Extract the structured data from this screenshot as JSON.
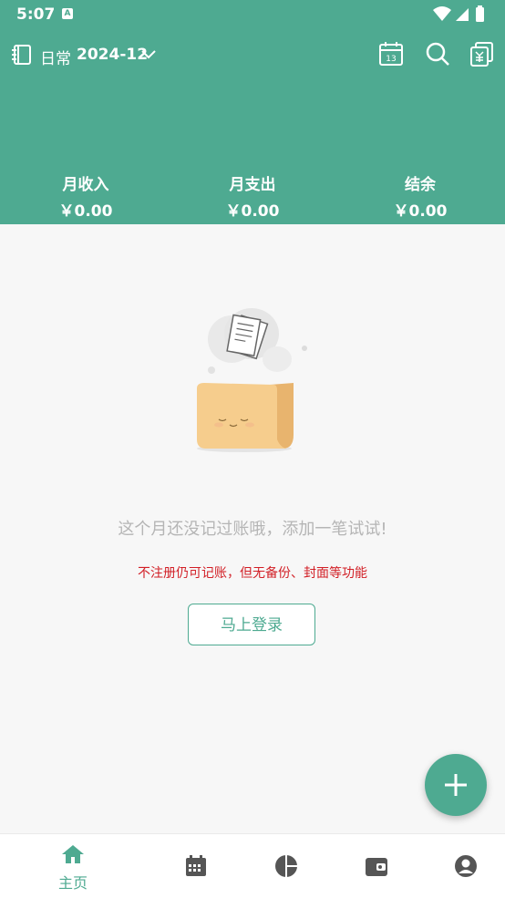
{
  "status": {
    "time": "5:07",
    "notif_badge": "A"
  },
  "toolbar": {
    "book_name": "日常",
    "month": "2024-12",
    "icons": [
      "book-icon",
      "chevron-down-icon",
      "calendar-13-icon",
      "search-icon",
      "bills-icon"
    ],
    "calendar_day": "13"
  },
  "summary": {
    "income_label": "月收入",
    "income_value": "￥0.00",
    "expense_label": "月支出",
    "expense_value": "￥0.00",
    "balance_label": "结余",
    "balance_value": "￥0.00"
  },
  "empty": {
    "message": "这个月还没记过账哦，添加一笔试试!",
    "note": "不注册仍可记账，但无备份、封面等功能",
    "login_button": "马上登录"
  },
  "nav": {
    "items": [
      {
        "label": "主页",
        "icon": "home-icon",
        "active": true
      },
      {
        "label": "",
        "icon": "calendar-icon"
      },
      {
        "label": "",
        "icon": "pie-chart-icon"
      },
      {
        "label": "",
        "icon": "wallet-icon"
      },
      {
        "label": "",
        "icon": "profile-icon"
      }
    ]
  },
  "colors": {
    "primary": "#4eaa91",
    "warning": "#d21f26",
    "muted": "#b5b5b5"
  }
}
